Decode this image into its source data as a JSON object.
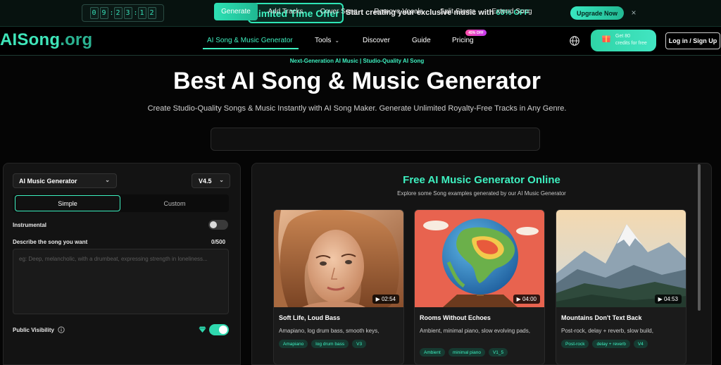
{
  "banner": {
    "timer_digits": [
      "0",
      "9",
      "2",
      "3",
      "1",
      "2"
    ],
    "timer_separator": ":",
    "offer_label": "Limited Time Offer",
    "offer_text": "Start creating your exclusive music with",
    "offer_discount": "60% OFF",
    "upgrade_label": "Upgrade Now",
    "close_glyph": "×",
    "icons": [
      "cart-icon",
      "close-icon"
    ]
  },
  "nav": {
    "logo_main": "AISong",
    "logo_tld": ".org",
    "items": [
      {
        "label": "AI Song & Music Generator",
        "active": true
      },
      {
        "label": "Tools",
        "has_dropdown": true
      },
      {
        "label": "Discover"
      },
      {
        "label": "Guide"
      },
      {
        "label": "Pricing",
        "badge": "45% OFF"
      }
    ],
    "credits_line1": "Get 80",
    "credits_line2": "credits for free",
    "login_label": "Log in / Sign Up",
    "icons": [
      "globe-icon",
      "gift-icon"
    ]
  },
  "hero": {
    "tagline": "Next-Generation AI Music | Studio-Quality AI Song",
    "title": "Best AI Song & Music Generator",
    "subtitle": "Create Studio-Quality Songs & Music Instantly with AI Song Maker. Generate Unlimited Royalty-Free Tracks in Any Genre.",
    "tabs": [
      {
        "label": "Generate",
        "active": true
      },
      {
        "label": "Add Tracks"
      },
      {
        "label": "Cover Song"
      },
      {
        "label": "Remove Vocals"
      },
      {
        "label": "Split Stems"
      },
      {
        "label": "Extend Song"
      }
    ]
  },
  "form": {
    "model_value": "AI Music Generator",
    "version_value": "V4.5",
    "mode_simple": "Simple",
    "mode_custom": "Custom",
    "mode_selected": "Simple",
    "instrumental_label": "Instrumental",
    "instrumental_on": false,
    "describe_label": "Describe the song you want",
    "char_count": "0/500",
    "describe_value": "",
    "describe_placeholder": "eg: Deep, melancholic, with a drumbeat, expressing strength in loneliness...",
    "visibility_label": "Public Visibility",
    "visibility_on": true,
    "icons": [
      "chevron-down-icon",
      "info-icon",
      "diamond-icon"
    ]
  },
  "examples": {
    "title": "Free AI Music Generator Online",
    "subtitle": "Explore some Song examples generated by our AI Music Generator",
    "accent_color": "#3ef0c0",
    "cards": [
      {
        "title": "Soft Life, Loud Bass",
        "desc": "Amapiano, log drum bass, smooth keys,",
        "duration": "02:54",
        "tags": [
          "Amapiano",
          "log drum bass",
          "V3"
        ],
        "image": "woman-portrait"
      },
      {
        "title": "Rooms Without Echoes",
        "desc": "Ambient, minimal piano, slow evolving pads,",
        "duration": "04:00",
        "tags": [
          "Ambient",
          "minimal piano",
          "V1_5"
        ],
        "image": "globe-illustration"
      },
      {
        "title": "Mountains Don't Text Back",
        "desc": "Post-rock, delay + reverb, slow build,",
        "duration": "04:53",
        "tags": [
          "Post-rock",
          "delay + reverb",
          "V4"
        ],
        "image": "mountain-landscape"
      }
    ],
    "play_glyph": "▶"
  }
}
